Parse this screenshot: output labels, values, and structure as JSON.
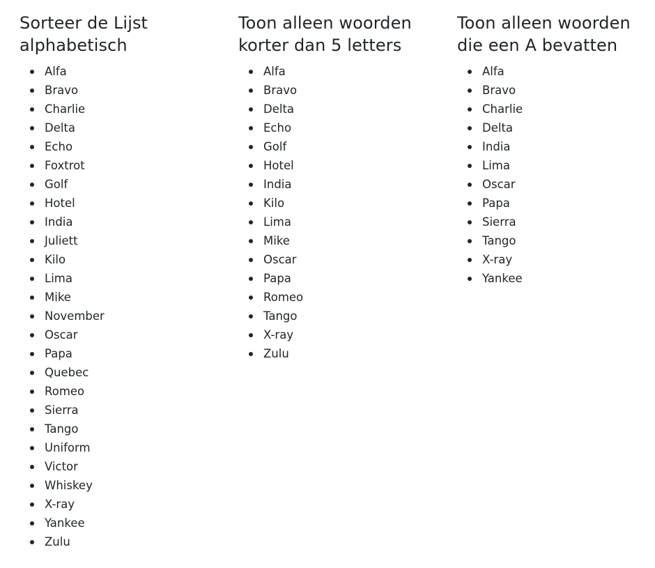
{
  "columns": [
    {
      "title": "Sorteer de Lijst alphabetisch",
      "items": [
        "Alfa",
        "Bravo",
        "Charlie",
        "Delta",
        "Echo",
        "Foxtrot",
        "Golf",
        "Hotel",
        "India",
        "Juliett",
        "Kilo",
        "Lima",
        "Mike",
        "November",
        "Oscar",
        "Papa",
        "Quebec",
        "Romeo",
        "Sierra",
        "Tango",
        "Uniform",
        "Victor",
        "Whiskey",
        "X-ray",
        "Yankee",
        "Zulu"
      ]
    },
    {
      "title": "Toon alleen woorden korter dan 5 letters",
      "items": [
        "Alfa",
        "Bravo",
        "Delta",
        "Echo",
        "Golf",
        "Hotel",
        "India",
        "Kilo",
        "Lima",
        "Mike",
        "Oscar",
        "Papa",
        "Romeo",
        "Tango",
        "X-ray",
        "Zulu"
      ]
    },
    {
      "title": "Toon alleen woorden die een A bevatten",
      "items": [
        "Alfa",
        "Bravo",
        "Charlie",
        "Delta",
        "India",
        "Lima",
        "Oscar",
        "Papa",
        "Sierra",
        "Tango",
        "X-ray",
        "Yankee"
      ]
    }
  ]
}
